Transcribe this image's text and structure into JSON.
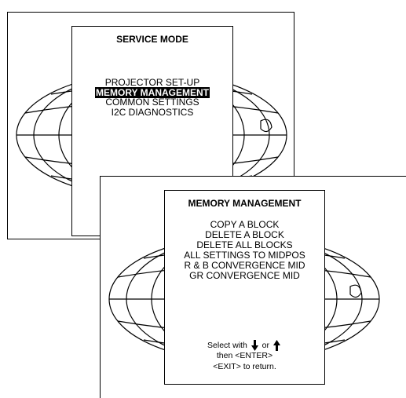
{
  "screen1": {
    "title": "SERVICE MODE",
    "items": [
      {
        "label": "PROJECTOR SET-UP",
        "selected": false
      },
      {
        "label": "MEMORY MANAGEMENT",
        "selected": true
      },
      {
        "label": "COMMON SETTINGS",
        "selected": false
      },
      {
        "label": "I2C DIAGNOSTICS",
        "selected": false
      }
    ]
  },
  "screen2": {
    "title": "MEMORY MANAGEMENT",
    "items": [
      {
        "label": "COPY A BLOCK"
      },
      {
        "label": "DELETE A BLOCK"
      },
      {
        "label": "DELETE ALL BLOCKS"
      },
      {
        "label": "ALL SETTINGS TO MIDPOS"
      },
      {
        "label": "R & B CONVERGENCE MID"
      },
      {
        "label": "GR CONVERGENCE MID"
      }
    ],
    "footer": {
      "select_prefix": "Select with",
      "select_or": "or",
      "line2": "then <ENTER>",
      "line3": "<EXIT> to return."
    }
  },
  "icons": {
    "down": "arrow-down-icon",
    "up": "arrow-up-icon",
    "background": "globe-icon"
  }
}
